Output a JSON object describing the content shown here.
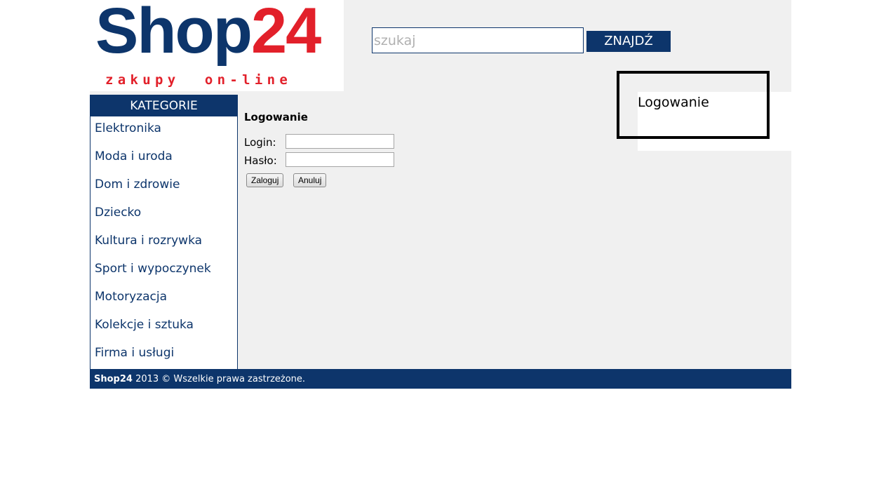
{
  "logo": {
    "title_part1": "Shop",
    "title_part2": "24",
    "tagline": "zakupy  on-line",
    "brand_colors": {
      "blue": "#0d356b",
      "red": "#e2202a"
    }
  },
  "search": {
    "placeholder": "szukaj",
    "value": "",
    "button_label": "ZNAJDŹ"
  },
  "login_box": {
    "title": "Logowanie"
  },
  "sidebar": {
    "header": "KATEGORIE",
    "items": [
      {
        "label": "Elektronika"
      },
      {
        "label": "Moda i uroda"
      },
      {
        "label": "Dom i zdrowie"
      },
      {
        "label": "Dziecko"
      },
      {
        "label": "Kultura i rozrywka"
      },
      {
        "label": "Sport i wypoczynek"
      },
      {
        "label": "Motoryzacja"
      },
      {
        "label": "Kolekcje i sztuka"
      },
      {
        "label": "Firma i usługi"
      }
    ]
  },
  "main": {
    "title": "Logowanie",
    "login_label": "Login:",
    "password_label": "Hasło:",
    "login_value": "",
    "password_value": "",
    "submit_label": "Zaloguj",
    "cancel_label": "Anuluj"
  },
  "footer": {
    "brand": "Shop24",
    "text": " 2013 © Wszelkie prawa zastrzeżone."
  }
}
